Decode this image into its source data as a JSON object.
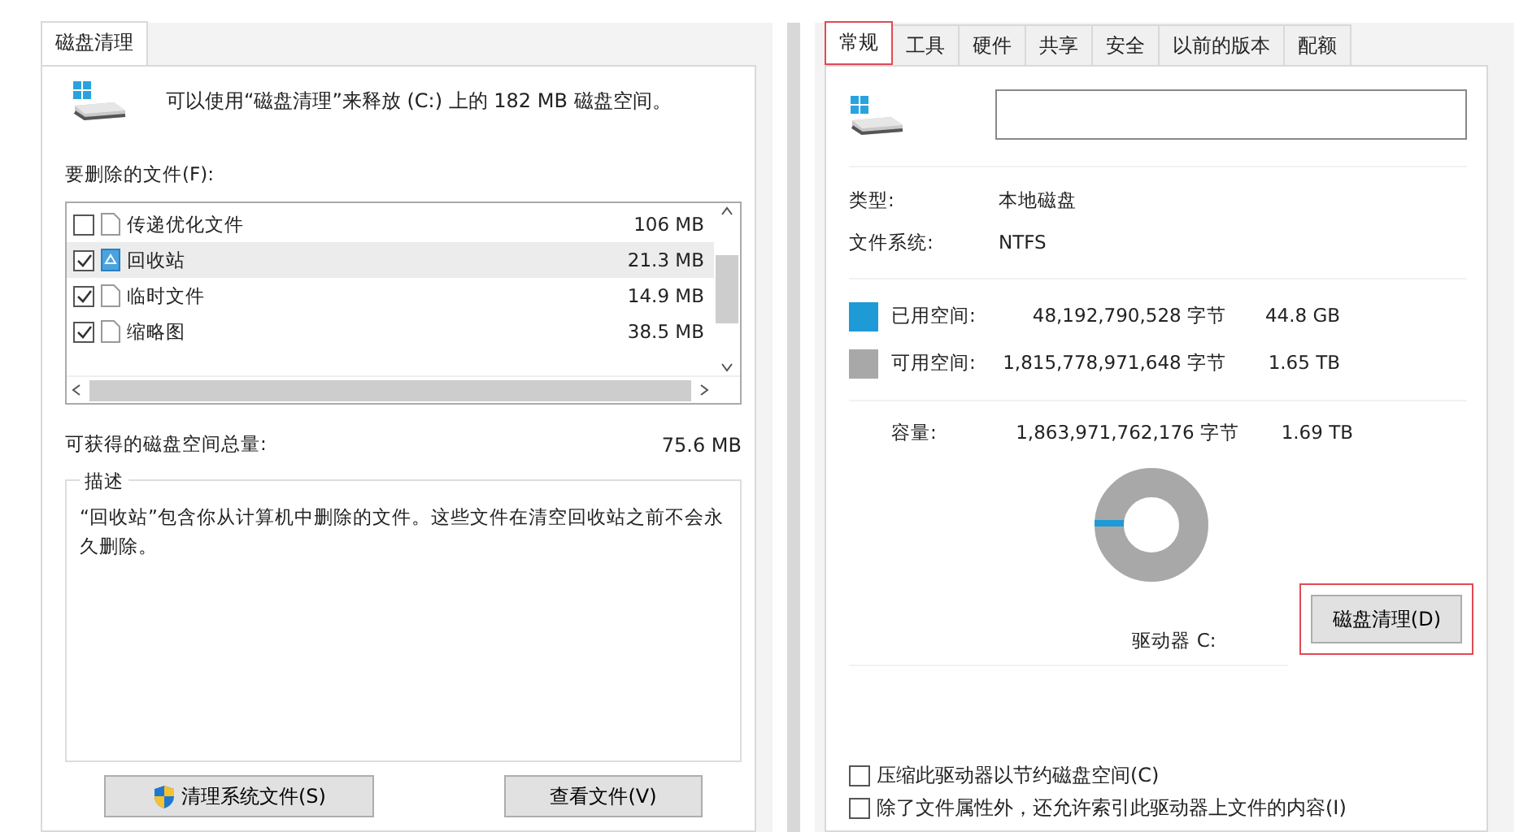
{
  "left": {
    "tabs": [
      {
        "label": "磁盘清理",
        "selected": true
      }
    ],
    "intro": "可以使用“磁盘清理”来释放 (C:) 上的 182 MB 磁盘空间。",
    "files_label": "要删除的文件(F):",
    "files": [
      {
        "name": "传递优化文件",
        "size": "106 MB",
        "checked": false,
        "selected": false,
        "kind": "file"
      },
      {
        "name": "回收站",
        "size": "21.3 MB",
        "checked": true,
        "selected": true,
        "kind": "recycle"
      },
      {
        "name": "临时文件",
        "size": "14.9 MB",
        "checked": true,
        "selected": false,
        "kind": "file"
      },
      {
        "name": "缩略图",
        "size": "38.5 MB",
        "checked": true,
        "selected": false,
        "kind": "file"
      }
    ],
    "total_label": "可获得的磁盘空间总量:",
    "total_value": "75.6 MB",
    "description": {
      "title": "描述",
      "text": "“回收站”包含你从计算机中删除的文件。这些文件在清空回收站之前不会永久删除。"
    },
    "buttons": [
      {
        "label": "清理系统文件(S)",
        "kind": "shield"
      },
      {
        "label": "查看文件(V)",
        "kind": "plain"
      }
    ]
  },
  "right": {
    "tabs": [
      {
        "label": "常规",
        "selected": true,
        "highlighted": true
      },
      {
        "label": "工具",
        "selected": false,
        "highlighted": false
      },
      {
        "label": "硬件",
        "selected": false,
        "highlighted": false
      },
      {
        "label": "共享",
        "selected": false,
        "highlighted": false
      },
      {
        "label": "安全",
        "selected": false,
        "highlighted": false
      },
      {
        "label": "以前的版本",
        "selected": false,
        "highlighted": false
      },
      {
        "label": "配额",
        "selected": false,
        "highlighted": false
      }
    ],
    "info": [
      {
        "label": "类型:",
        "value": "本地磁盘"
      },
      {
        "label": "文件系统:",
        "value": "NTFS"
      }
    ],
    "space": [
      {
        "label": "已用空间:",
        "bytes": "48,192,790,528 字节",
        "size": "44.8 GB",
        "color": "#1e9ad6"
      },
      {
        "label": "可用空间:",
        "bytes": "1,815,778,971,648 字节",
        "size": "1.65 TB",
        "color": "#a8a8a8"
      }
    ],
    "capacity": {
      "label": "容量:",
      "bytes": "1,863,971,762,176 字节",
      "size": "1.69 TB"
    },
    "drive_label": "驱动器 C:",
    "cleanup_button": {
      "label": "磁盘清理(D)",
      "highlighted": true
    },
    "options": [
      {
        "label": "压缩此驱动器以节约磁盘空间(C)",
        "checked": false
      },
      {
        "label": "除了文件属性外，还允许索引此驱动器上文件的内容(I)",
        "checked": false
      }
    ]
  }
}
